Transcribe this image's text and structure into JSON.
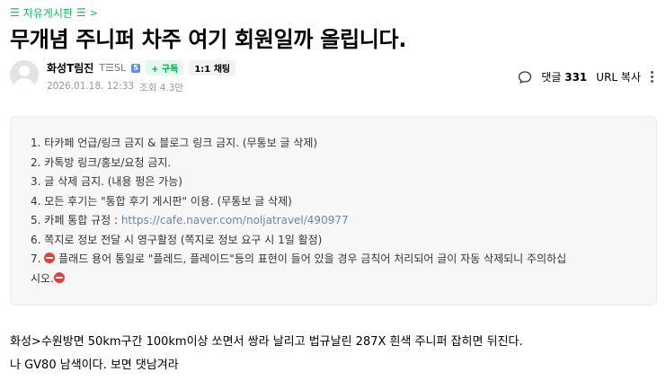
{
  "board": {
    "label": "자유게시판"
  },
  "post": {
    "title": "무개념 주니퍼 차주 여기 회원일까 올립니다.",
    "author": "화성T림진",
    "grade_label": "T☰SL",
    "grade_badge": "5",
    "follow_label": "+ 구독",
    "chat_label": "1:1 채팅",
    "date": "2026.01.18. 12:33",
    "views_label": "조회 4.3만",
    "comments_label": "댓글",
    "comments_count": "331",
    "url_copy_label": "URL 복사"
  },
  "notice": {
    "items": [
      {
        "no": "1.",
        "text": "타카페 언급/링크 금지 & 블로그 링크 금지. (무통보 글 삭제)"
      },
      {
        "no": "2.",
        "text": "카톡방 링크/홍보/요청 금지."
      },
      {
        "no": "3.",
        "text": "글 삭제 금지. (내용 펑은 가능)"
      },
      {
        "no": "4.",
        "text": "모든 후기는 \"통합 후기 게시판\" 이용. (무통보 글 삭제)"
      },
      {
        "no": "5.",
        "text": "카페 통합 규정 : ",
        "link": "https://cafe.naver.com/noljatravel/490977"
      },
      {
        "no": "6.",
        "text": "쪽지로 정보 전달 시 영구활정 (쪽지로 정보 요구 시 1일 활정)"
      },
      {
        "no": "7.",
        "line1": "플래드 용어 통일로 \"플레드, 플레이드\"등의 표현이 들어 있을 경우 금칙어 처리되어 글이 자동 삭제되니 주의하십",
        "line2": "시오."
      }
    ]
  },
  "content": {
    "lines": [
      "화성>수원방면 50km구간 100km이상 쏘면서 쌍라 날리고 법규날린 287X 흰색 주니퍼 잡히면 뒤진다.",
      "나 GV80 남색이다. 보면 댓남겨라"
    ]
  },
  "colors": {
    "brand_green": "#03c75a",
    "link": "#6f84a8",
    "notice_bg": "#f7f7f7"
  }
}
